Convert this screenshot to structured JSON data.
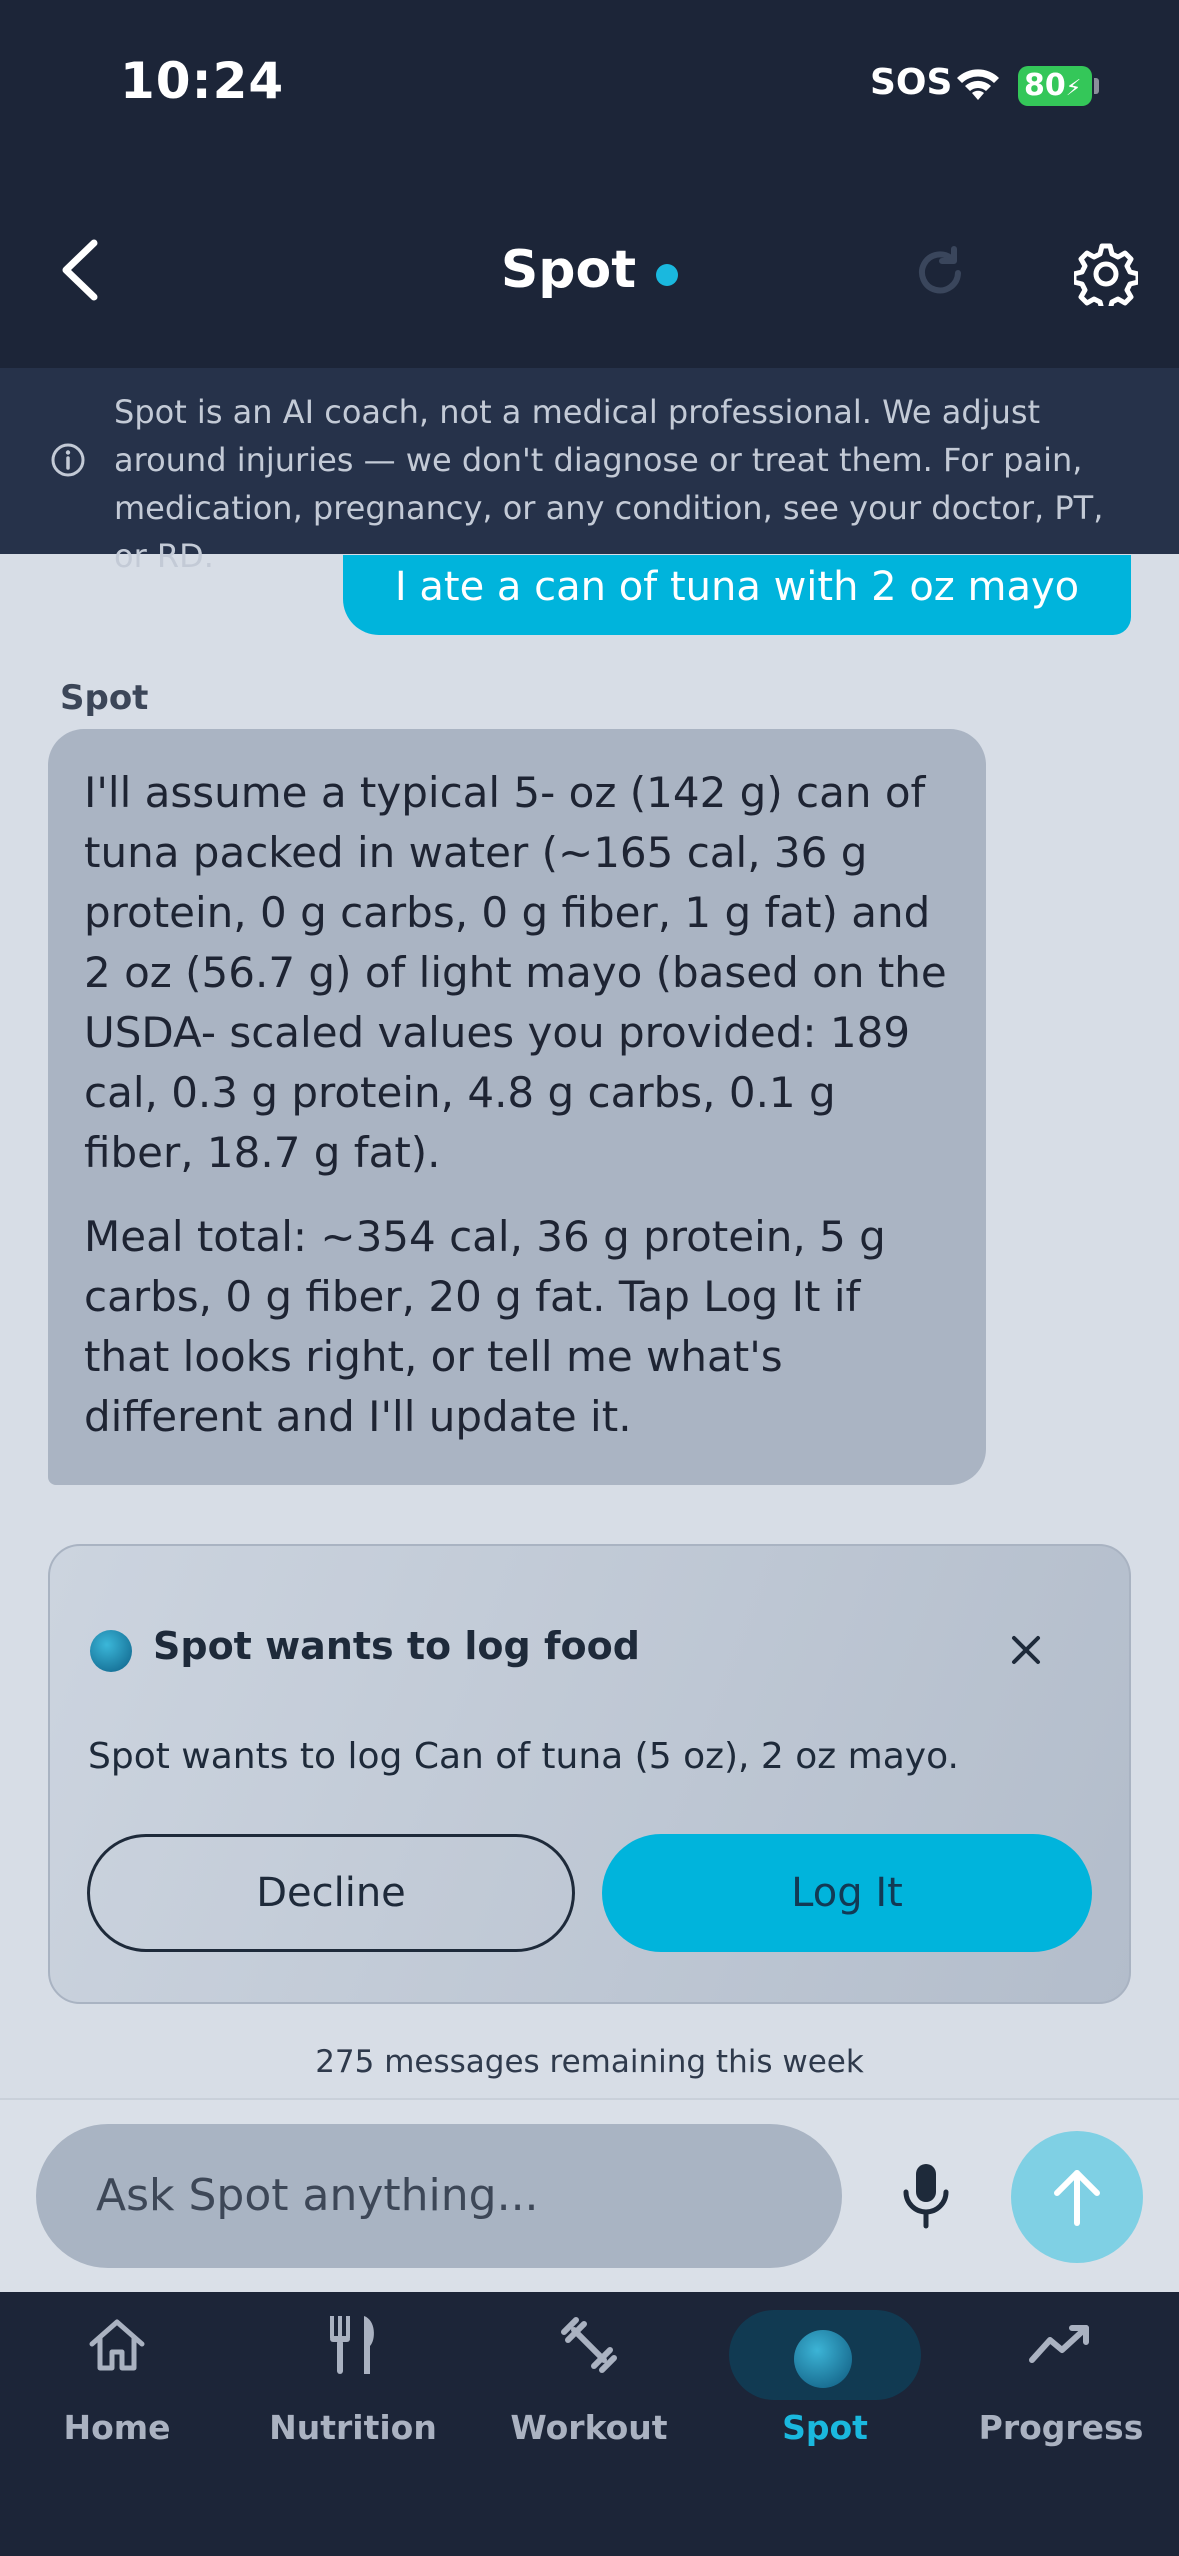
{
  "status_bar": {
    "time": "10:24",
    "sos": "SOS",
    "battery": "80"
  },
  "header": {
    "title": "Spot"
  },
  "disclaimer": {
    "text": "Spot is an AI coach, not a medical professional. We adjust around injuries — we don't diagnose or treat them. For pain, medication, pregnancy, or any condition, see your doctor, PT, or RD."
  },
  "chat": {
    "user_message": "I ate a can of tuna with 2 oz mayo",
    "assistant_name": "Spot",
    "assistant_paragraphs": [
      "I'll assume a typical 5- oz (142 g) can of tuna packed in water (~165 cal, 36 g protein, 0 g carbs, 0 g fiber, 1 g fat) and 2 oz (56.7 g) of light mayo (based on the USDA- scaled values you provided: 189 cal, 0.3 g protein, 4.8 g carbs, 0.1 g fiber, 18.7 g fat).",
      "Meal total: ~354 cal, 36 g protein, 5 g carbs, 0 g fiber, 20 g fat. Tap Log It if that looks right, or tell me what's different and I'll update it."
    ]
  },
  "log_card": {
    "title": "Spot wants to log food",
    "message": "Spot wants to log Can of tuna (5 oz), 2 oz mayo.",
    "decline_label": "Decline",
    "confirm_label": "Log It"
  },
  "remaining_text": "275 messages remaining this week",
  "composer": {
    "placeholder": "Ask Spot anything..."
  },
  "nav": {
    "items": [
      {
        "label": "Home",
        "icon": "home-icon"
      },
      {
        "label": "Nutrition",
        "icon": "fork-knife-icon"
      },
      {
        "label": "Workout",
        "icon": "dumbbell-icon"
      },
      {
        "label": "Spot",
        "icon": "spot-orb-icon",
        "active": true
      },
      {
        "label": "Progress",
        "icon": "trend-icon"
      }
    ]
  },
  "colors": {
    "accent": "#00b4dc",
    "header_bg": "#1c2538",
    "background": "#d7dde6",
    "battery": "#34c759"
  }
}
